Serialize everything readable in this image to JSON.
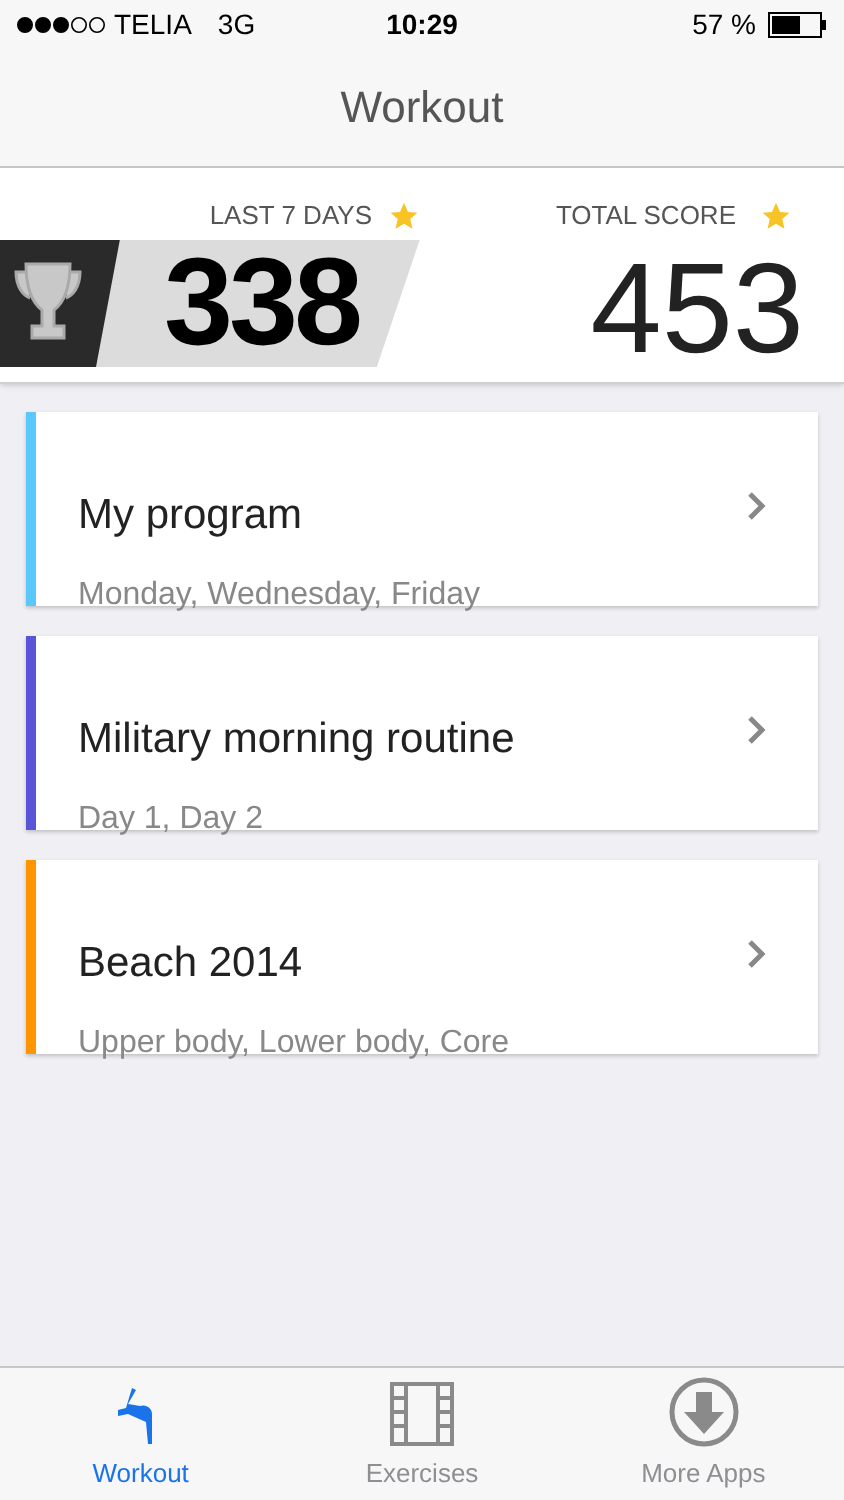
{
  "status_bar": {
    "carrier": "TELIA",
    "network": "3G",
    "time": "10:29",
    "battery": "57 %"
  },
  "nav_bar": {
    "title": "Workout"
  },
  "scores": {
    "recent_label": "LAST 7 DAYS",
    "recent_value": "338",
    "total_label": "TOTAL SCORE",
    "total_value": "453"
  },
  "programs": [
    {
      "title": "My program",
      "days": "Monday, Wednesday, Friday",
      "color": "#5ac8fa"
    },
    {
      "title": "Military morning routine",
      "days": "Day 1, Day 2",
      "color": "#5856d6"
    },
    {
      "title": "Beach 2014",
      "days": "Upper body, Lower body, Core",
      "color": "#ff9500"
    }
  ],
  "tab_bar": [
    {
      "label": "Workout",
      "kind": "workout",
      "selected": true
    },
    {
      "label": "Exercises",
      "kind": "film",
      "selected": false
    },
    {
      "label": "More Apps",
      "kind": "download",
      "selected": false
    }
  ]
}
